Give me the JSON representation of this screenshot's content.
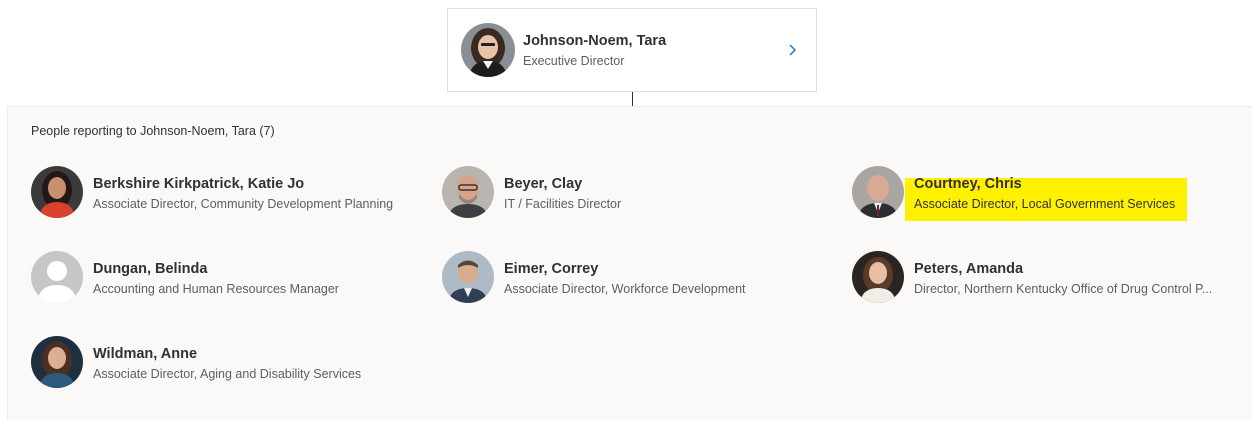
{
  "manager": {
    "name": "Johnson-Noem, Tara",
    "title": "Executive Director",
    "avatar_icon": "person-photo-icon",
    "chevron_icon": "chevron-right-icon"
  },
  "reports": {
    "heading": "People reporting to Johnson-Noem, Tara (7)",
    "people": [
      {
        "name": "Berkshire Kirkpatrick, Katie Jo",
        "title": "Associate Director, Community Development Planning"
      },
      {
        "name": "Beyer, Clay",
        "title": "IT / Facilities Director"
      },
      {
        "name": "Courtney, Chris",
        "title": "Associate Director, Local Government Services",
        "highlighted": true
      },
      {
        "name": "Dungan, Belinda",
        "title": "Accounting and Human Resources Manager",
        "avatar": "default-avatar-icon"
      },
      {
        "name": "Eimer, Correy",
        "title": "Associate Director, Workforce Development"
      },
      {
        "name": "Peters, Amanda",
        "title": "Director, Northern Kentucky Office of Drug Control P..."
      },
      {
        "name": "Wildman, Anne",
        "title": "Associate Director, Aging and Disability Services"
      }
    ]
  },
  "colors": {
    "highlight": "#fff100",
    "panel_background": "#faf9f8",
    "card_border": "#e1dfdd",
    "chevron": "#0078d4"
  }
}
